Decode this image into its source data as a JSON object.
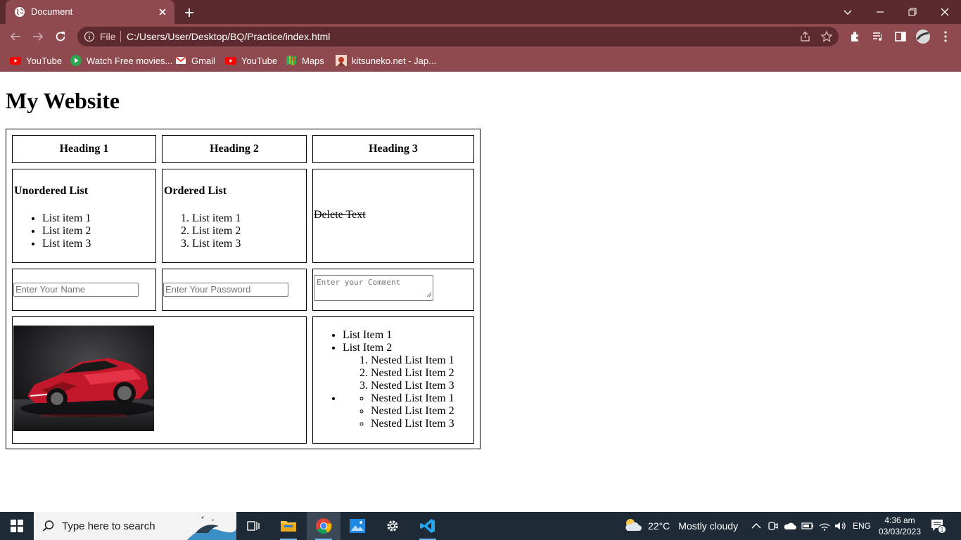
{
  "browser": {
    "tab_title": "Document",
    "omnibox": {
      "scheme_label": "File",
      "url": "C:/Users/User/Desktop/BQ/Practice/index.html"
    },
    "bookmarks": [
      {
        "label": "YouTube",
        "icon": "youtube-icon"
      },
      {
        "label": "Watch Free movies...",
        "icon": "play-icon"
      },
      {
        "label": "Gmail",
        "icon": "gmail-icon"
      },
      {
        "label": "YouTube",
        "icon": "youtube-icon"
      },
      {
        "label": "Maps",
        "icon": "maps-icon"
      },
      {
        "label": "kitsuneko.net - Jap...",
        "icon": "site-icon"
      }
    ]
  },
  "page": {
    "title": "My Website",
    "headings": [
      "Heading 1",
      "Heading 2",
      "Heading 3"
    ],
    "unordered": {
      "title": "Unordered List",
      "items": [
        "List item 1",
        "List item 2",
        "List item 3"
      ]
    },
    "ordered": {
      "title": "Ordered List",
      "items": [
        "List item 1",
        "List item 2",
        "List item 3"
      ]
    },
    "deleted_text": "Delete Text",
    "name_input": {
      "placeholder": "Enter Your Name"
    },
    "password_input": {
      "placeholder": "Enter Your Password"
    },
    "comment_input": {
      "placeholder": "Enter your Comment"
    },
    "nested": {
      "items": [
        "List Item 1",
        "List Item 2"
      ],
      "ordered_sub": [
        "Nested List Item 1",
        "Nested List Item 2",
        "Nested List Item 3"
      ],
      "circle_sub": [
        "Nested List Item 1",
        "Nested List Item 2",
        "Nested List Item 3"
      ]
    }
  },
  "taskbar": {
    "search_placeholder": "Type here to search",
    "weather": {
      "temp": "22°C",
      "desc": "Mostly cloudy"
    },
    "language": "ENG",
    "time": "4:36 am",
    "date": "03/03/2023",
    "notification_count": "1"
  },
  "colors": {
    "tab_strip": "#5a2a2f",
    "toolbar": "#8e4a4f",
    "taskbar": "#1e2b36"
  }
}
